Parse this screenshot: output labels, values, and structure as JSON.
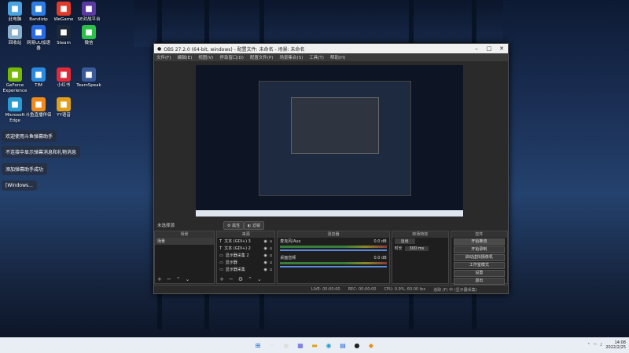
{
  "desktop_icons": [
    {
      "label": "此电脑",
      "icon": "computer-icon",
      "color": "#4aa3e0"
    },
    {
      "label": "Bandizip",
      "icon": "bandizip-icon",
      "color": "#2d7de0"
    },
    {
      "label": "WeGame",
      "icon": "wegame-icon",
      "color": "#e03a2a"
    },
    {
      "label": "SE对战平台",
      "icon": "se-platform-icon",
      "color": "#5a3aa0"
    },
    {
      "label": "回收站",
      "icon": "recycle-bin-icon",
      "color": "#8ab0d0"
    },
    {
      "label": "网易UU加速器",
      "icon": "uu-accelerator-icon",
      "color": "#2a6ae0"
    },
    {
      "label": "Steam",
      "icon": "steam-icon",
      "color": "#1b2838"
    },
    {
      "label": "微信",
      "icon": "wechat-icon",
      "color": "#2ac04a"
    },
    {
      "label": "GeForce Experience",
      "icon": "geforce-icon",
      "color": "#76b900"
    },
    {
      "label": "TIM",
      "icon": "tim-icon",
      "color": "#2a8ae0"
    },
    {
      "label": "小红书",
      "icon": "xiaohongshu-icon",
      "color": "#e02a3a"
    },
    {
      "label": "TeamSpeak",
      "icon": "teamspeak-icon",
      "color": "#3a5a9a"
    },
    {
      "label": "Microsoft Edge",
      "icon": "edge-icon",
      "color": "#2a9ad0"
    },
    {
      "label": "斗鱼直播伴侣",
      "icon": "douyu-icon",
      "color": "#f08a1a"
    },
    {
      "label": "YY语音",
      "icon": "yy-icon",
      "color": "#e0a01a"
    }
  ],
  "notifications": [
    "欢迎使用斗鱼弹幕助手",
    "不连接中显示弹幕消息和礼物消息",
    "添加弹幕助手成功",
    "[Windows..."
  ],
  "obs": {
    "title": "OBS 27.2.0 (64-bit, windows) - 配置文件: 未命名 - 场景: 未命名",
    "menu": [
      "文件(F)",
      "编辑(E)",
      "视图(V)",
      "停靠窗口(D)",
      "配置文件(P)",
      "场景集合(S)",
      "工具(T)",
      "帮助(H)"
    ],
    "no_source": "未选择源",
    "properties": "属性",
    "filters": "滤镜",
    "docks": {
      "scenes": {
        "header": "场景",
        "items": [
          "场景"
        ]
      },
      "sources": {
        "header": "来源",
        "items": [
          "文本 (GDI+) 3",
          "文本 (GDI+) 2",
          "显示器采集 2",
          "显示器",
          "显示器采集"
        ]
      },
      "mixer": {
        "header": "混音器",
        "ch1": "麦克风/Aux",
        "ch1_db": "0.0 dB",
        "ch2": "桌面音频",
        "ch2_db": "0.0 dB"
      },
      "transitions": {
        "header": "转场特效",
        "fade": "淡出",
        "duration_label": "时长",
        "duration": "300 ms"
      },
      "controls": {
        "header": "控件",
        "buttons": [
          "开始推流",
          "开始录制",
          "启动虚拟摄像机",
          "工作室模式",
          "设置",
          "退出"
        ]
      }
    },
    "status": {
      "live": "LIVE: 00:00:00",
      "rec": "REC: 00:00:00",
      "cpu": "CPU: 0.9%, 60.00 fps",
      "hint": "追踪 (F) 中 (显示器采集)"
    }
  },
  "taskbar": {
    "time": "14:08",
    "date": "2022/2/25"
  }
}
